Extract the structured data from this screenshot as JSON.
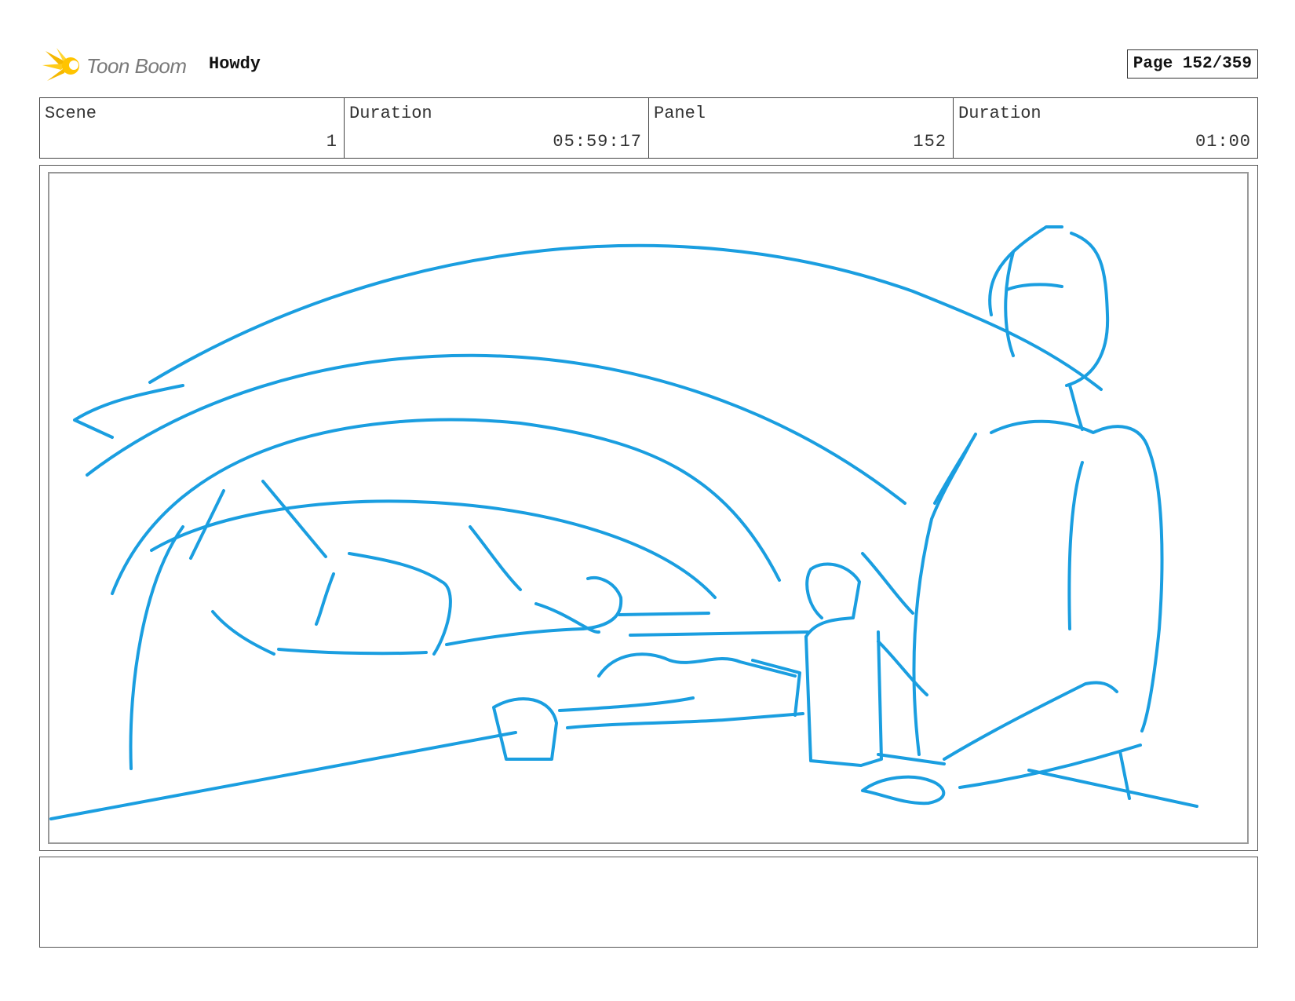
{
  "header": {
    "logo_text": "Toon Boom",
    "project": "Howdy",
    "page": "Page 152/359"
  },
  "info": {
    "scene_label": "Scene",
    "scene_value": "1",
    "scene_duration_label": "Duration",
    "scene_duration_value": "05:59:17",
    "panel_label": "Panel",
    "panel_value": "152",
    "panel_duration_label": "Duration",
    "panel_duration_value": "01:00"
  },
  "notes": "",
  "colors": {
    "sketch": "#1a9ee0",
    "logo_yellow": "#f5b800",
    "border": "#444444"
  },
  "icons": {
    "logo": "toon-boom-logo-icon"
  }
}
